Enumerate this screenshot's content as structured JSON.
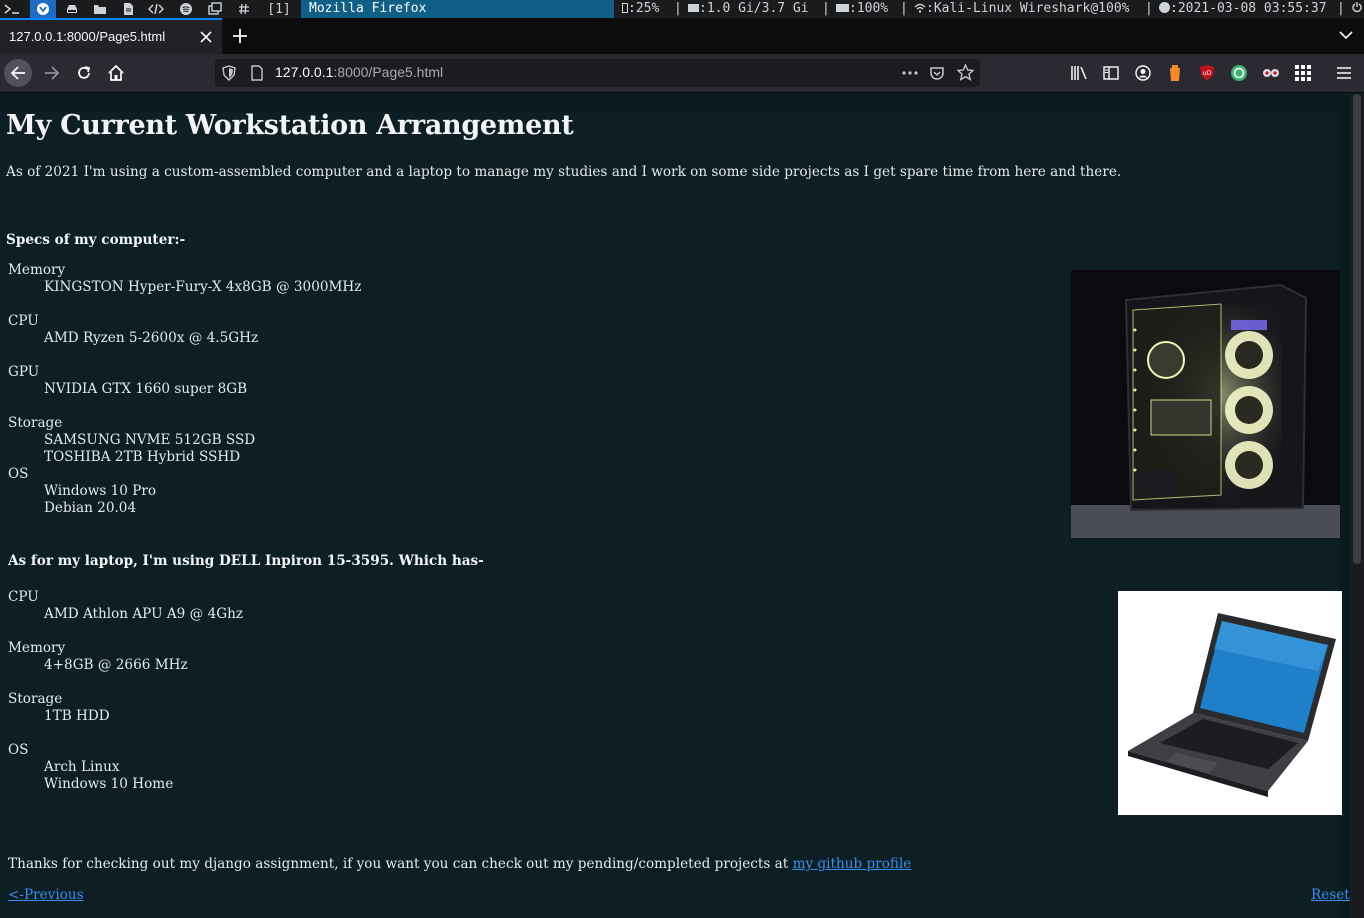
{
  "system_bar": {
    "workspace_label": "[1]",
    "window_title": "Mozilla Firefox",
    "cpu": ":25%",
    "memory": ":1.0 Gi/3.7 Gi",
    "battery": ":100%",
    "network": ":Kali-Linux Wireshark@100%",
    "datetime": ":2021-03-08 03:55:37",
    "separator": "|"
  },
  "browser": {
    "tab_title": "127.0.0.1:8000/Page5.html",
    "url_host": "127.0.0.1",
    "url_rest": ":8000/Page5.html",
    "accent_color": "#0a84ff"
  },
  "page": {
    "title": "My Current Workstation Arrangement",
    "intro": "As of 2021 I'm using a custom-assembled computer and a laptop to manage my studies and I work on some side projects as I get spare time from here and there.",
    "computer_heading": "Specs of my computer:-",
    "computer_specs": [
      {
        "term": "Memory",
        "values": [
          "KINGSTON Hyper-Fury-X 4x8GB @ 3000MHz"
        ]
      },
      {
        "term": "CPU",
        "values": [
          "AMD Ryzen 5-2600x @ 4.5GHz"
        ]
      },
      {
        "term": "GPU",
        "values": [
          "NVIDIA GTX 1660 super 8GB"
        ]
      },
      {
        "term": "Storage",
        "values": [
          "SAMSUNG NVME 512GB SSD",
          "TOSHIBA 2TB Hybrid SSHD"
        ]
      },
      {
        "term": "OS",
        "values": [
          "Windows 10 Pro",
          "Debian 20.04"
        ]
      }
    ],
    "laptop_heading": "As for my laptop, I'm using DELL Inpiron 15-3595. Which has-",
    "laptop_specs": [
      {
        "term": "CPU",
        "values": [
          "AMD Athlon APU A9 @ 4Ghz"
        ]
      },
      {
        "term": "Memory",
        "values": [
          "4+8GB @ 2666 MHz"
        ]
      },
      {
        "term": "Storage",
        "values": [
          "1TB HDD"
        ]
      },
      {
        "term": "OS",
        "values": [
          "Arch Linux",
          "Windows 10 Home"
        ]
      }
    ],
    "thanks_text": "Thanks for checking out my django assignment, if you want you can check out my pending/completed projects at ",
    "github_link": "my github profile",
    "prev_link": "<-Previous",
    "reset_link": "Reset",
    "link_color": "#3b8eea",
    "background_color": "#0d1f24"
  }
}
